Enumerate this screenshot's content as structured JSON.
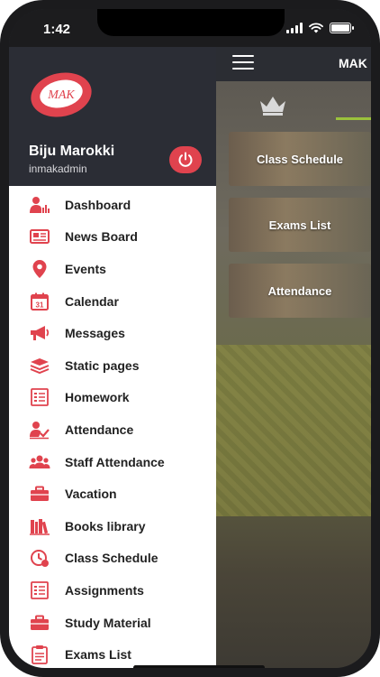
{
  "status_bar": {
    "time": "1:42"
  },
  "app_bar": {
    "title": "MAK"
  },
  "profile": {
    "name": "Biju Marokki",
    "username": "inmakadmin",
    "logo_text": "MAK"
  },
  "accent_color": "#e0434e",
  "tiles": [
    {
      "label": "Class Schedule"
    },
    {
      "label": "Exams List"
    },
    {
      "label": "Attendance"
    }
  ],
  "menu": [
    {
      "label": "Dashboard",
      "icon": "dashboard-icon"
    },
    {
      "label": "News Board",
      "icon": "newspaper-icon"
    },
    {
      "label": "Events",
      "icon": "location-pin-icon"
    },
    {
      "label": "Calendar",
      "icon": "calendar-icon"
    },
    {
      "label": "Messages",
      "icon": "megaphone-icon"
    },
    {
      "label": "Static pages",
      "icon": "layers-icon"
    },
    {
      "label": "Homework",
      "icon": "checklist-icon"
    },
    {
      "label": "Attendance",
      "icon": "user-check-icon"
    },
    {
      "label": "Staff Attendance",
      "icon": "group-icon"
    },
    {
      "label": "Vacation",
      "icon": "briefcase-icon"
    },
    {
      "label": "Books library",
      "icon": "books-icon"
    },
    {
      "label": "Class Schedule",
      "icon": "clock-icon"
    },
    {
      "label": "Assignments",
      "icon": "list-icon"
    },
    {
      "label": "Study Material",
      "icon": "briefcase-icon"
    },
    {
      "label": "Exams List",
      "icon": "clipboard-icon"
    }
  ]
}
